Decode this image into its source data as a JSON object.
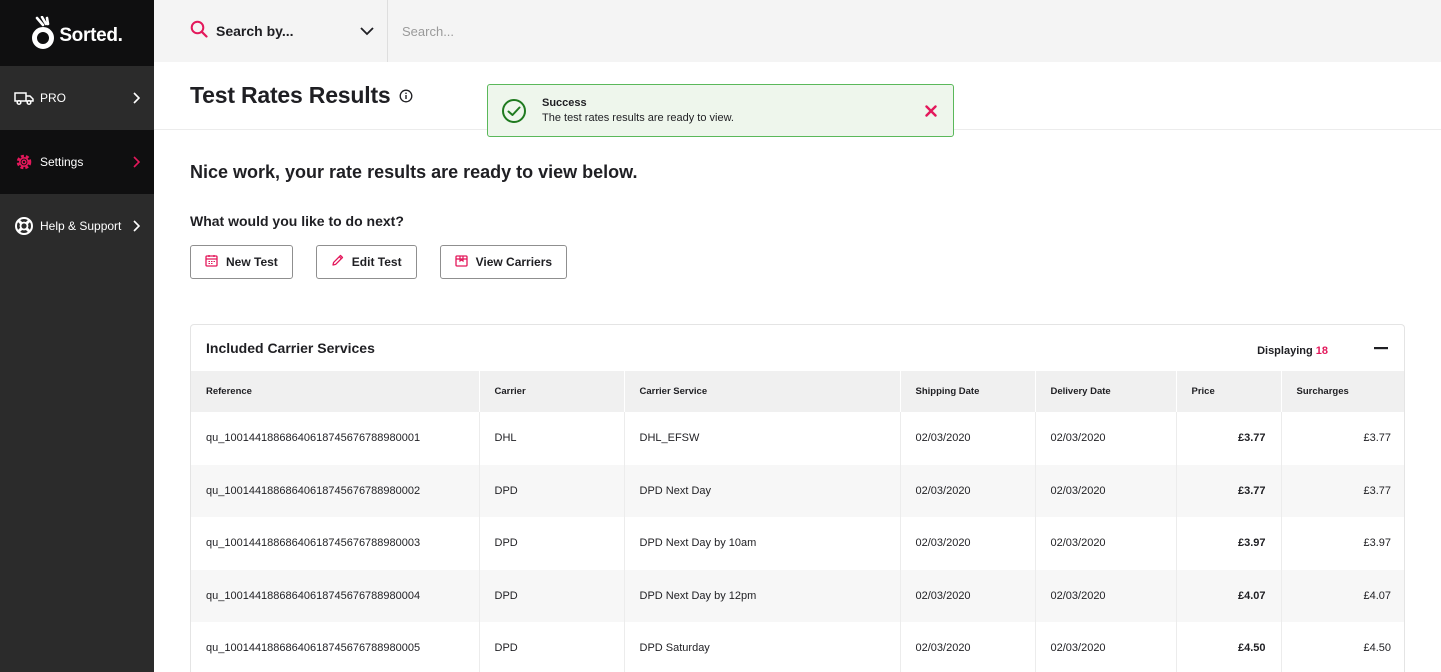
{
  "brand": {
    "name": "Sorted."
  },
  "sidebar": {
    "items": [
      {
        "label": "PRO",
        "icon": "truck-icon"
      },
      {
        "label": "Settings",
        "icon": "gear-icon"
      },
      {
        "label": "Help & Support",
        "icon": "lifebuoy-icon"
      }
    ]
  },
  "search": {
    "by_label": "Search by...",
    "placeholder": "Search..."
  },
  "page": {
    "title": "Test Rates Results"
  },
  "toast": {
    "title": "Success",
    "message": "The test rates results are ready to view."
  },
  "main": {
    "headline": "Nice work, your rate results are ready to view below.",
    "next_question": "What would you like to do next?",
    "buttons": {
      "new_test": "New Test",
      "edit_test": "Edit Test",
      "view_carriers": "View Carriers"
    }
  },
  "panel": {
    "title": "Included Carrier Services",
    "displaying_label": "Displaying",
    "displaying_count": "18"
  },
  "table": {
    "columns": [
      "Reference",
      "Carrier",
      "Carrier Service",
      "Shipping Date",
      "Delivery Date",
      "Price",
      "Surcharges"
    ],
    "rows": [
      [
        "qu_10014418868640618745676788980001",
        "DHL",
        "DHL_EFSW",
        "02/03/2020",
        "02/03/2020",
        "£3.77",
        "£3.77"
      ],
      [
        "qu_10014418868640618745676788980002",
        "DPD",
        "DPD Next Day",
        "02/03/2020",
        "02/03/2020",
        "£3.77",
        "£3.77"
      ],
      [
        "qu_10014418868640618745676788980003",
        "DPD",
        "DPD Next Day by 10am",
        "02/03/2020",
        "02/03/2020",
        "£3.97",
        "£3.97"
      ],
      [
        "qu_10014418868640618745676788980004",
        "DPD",
        "DPD Next Day by 12pm",
        "02/03/2020",
        "02/03/2020",
        "£4.07",
        "£4.07"
      ],
      [
        "qu_10014418868640618745676788980005",
        "DPD",
        "DPD Saturday",
        "02/03/2020",
        "02/03/2020",
        "£4.50",
        "£4.50"
      ]
    ]
  },
  "colors": {
    "accent": "#e3185b",
    "success": "#3aa63a",
    "sidebar": "#2b2b2b",
    "sidebar_active": "#0f0f10"
  }
}
